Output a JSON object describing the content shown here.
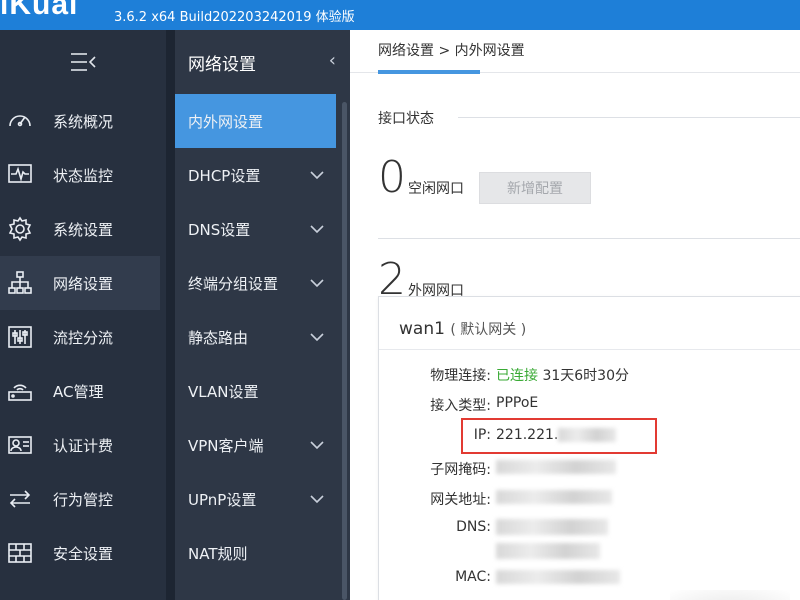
{
  "app": {
    "logo": "iKuai",
    "version": "3.6.2 x64 Build202203242019 体验版"
  },
  "sidebar": {
    "collapse_icon": "menu-collapse-icon",
    "items": [
      {
        "label": "系统概况",
        "icon": "dashboard-icon"
      },
      {
        "label": "状态监控",
        "icon": "monitor-icon"
      },
      {
        "label": "系统设置",
        "icon": "gear-icon"
      },
      {
        "label": "网络设置",
        "icon": "network-icon",
        "active": true
      },
      {
        "label": "流控分流",
        "icon": "sliders-icon"
      },
      {
        "label": "AC管理",
        "icon": "router-icon"
      },
      {
        "label": "认证计费",
        "icon": "id-card-icon"
      },
      {
        "label": "行为管控",
        "icon": "arrows-icon"
      },
      {
        "label": "安全设置",
        "icon": "firewall-icon"
      }
    ]
  },
  "subnav": {
    "title": "网络设置",
    "items": [
      {
        "label": "内外网设置",
        "active": true
      },
      {
        "label": "DHCP设置",
        "has_dropdown": true
      },
      {
        "label": "DNS设置",
        "has_dropdown": true
      },
      {
        "label": "终端分组设置",
        "has_dropdown": true
      },
      {
        "label": "静态路由",
        "has_dropdown": true
      },
      {
        "label": "VLAN设置"
      },
      {
        "label": "VPN客户端",
        "has_dropdown": true
      },
      {
        "label": "UPnP设置",
        "has_dropdown": true
      },
      {
        "label": "NAT规则"
      }
    ]
  },
  "main": {
    "breadcrumb": "网络设置 > 内外网设置",
    "section_title": "接口状态",
    "idle": {
      "count": "0",
      "label": "空闲网口",
      "add_button": "新增配置"
    },
    "wan": {
      "count": "2",
      "label": "外网网口"
    },
    "card": {
      "title": "wan1",
      "subtitle": "( 默认网关 )",
      "rows": {
        "link_label": "物理连接:",
        "link_status": "已连接",
        "link_uptime": "31天6时30分",
        "type_label": "接入类型:",
        "type_value": "PPPoE",
        "ip_label": "IP:",
        "ip_value": "221.221.",
        "mask_label": "子网掩码:",
        "gateway_label": "网关地址:",
        "dns_label": "DNS:",
        "mac_label": "MAC:"
      }
    }
  },
  "colors": {
    "topbar": "#1e7fd8",
    "sidebar": "#27303f",
    "subnav": "#2e3746",
    "active": "#4596e0",
    "connected": "#3aaa35",
    "highlight": "#e23a32"
  }
}
